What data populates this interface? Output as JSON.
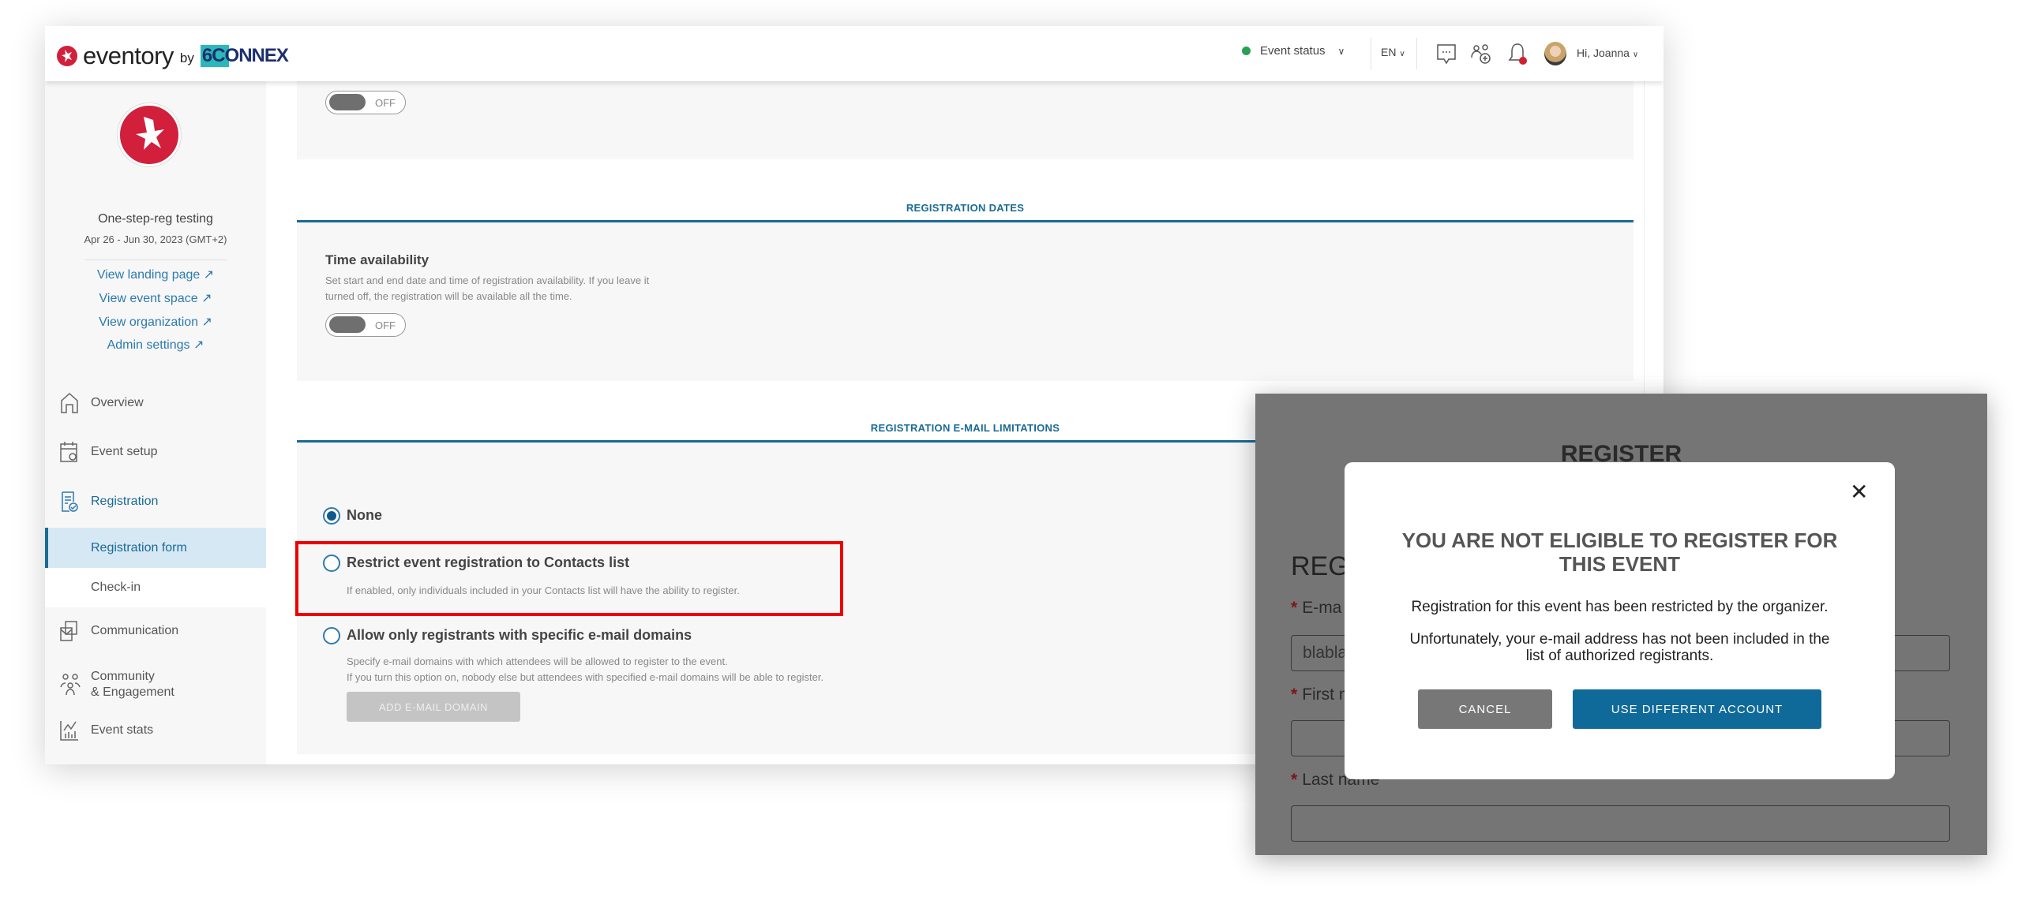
{
  "header": {
    "brand": "eventory",
    "by": "by",
    "partner": "6CONNEX",
    "event_status": "Event status",
    "status_color": "#2aa052",
    "language": "EN",
    "greeting": "Hi, Joanna"
  },
  "sidebar": {
    "event_name": "One-step-reg testing",
    "event_dates": "Apr 26 - Jun 30, 2023 (GMT+2)",
    "links": [
      "View landing page",
      "View event space",
      "View organization",
      "Admin settings"
    ],
    "nav": [
      {
        "label": "Overview",
        "icon": "home-icon"
      },
      {
        "label": "Event setup",
        "icon": "calendar-gear-icon"
      },
      {
        "label": "Registration",
        "icon": "registration-icon",
        "active": true
      },
      {
        "label": "Registration form",
        "sub": true,
        "selected": true
      },
      {
        "label": "Check-in",
        "sub": true
      },
      {
        "label": "Communication",
        "icon": "communication-icon"
      },
      {
        "label": "Community",
        "label2": "& Engagement",
        "icon": "community-icon"
      },
      {
        "label": "Event stats",
        "icon": "stats-icon"
      }
    ]
  },
  "main": {
    "top_toggle": "OFF",
    "registration_dates": {
      "title": "REGISTRATION DATES",
      "field": "Time availability",
      "description_line1": "Set start and end date and time of registration availability. If you leave it",
      "description_line2": "turned off, the registration will be available all the time.",
      "toggle": "OFF"
    },
    "email_limitations": {
      "title": "REGISTRATION E-MAIL LIMITATIONS",
      "options": [
        {
          "label": "None",
          "selected": true
        },
        {
          "label": "Restrict event registration to Contacts list",
          "description": "If enabled, only individuals included in your Contacts list will have the ability to register.",
          "highlighted": true
        },
        {
          "label": "Allow only registrants with specific e-mail domains",
          "description_line1": "Specify e-mail domains with which attendees will be allowed to register to the event.",
          "description_line2": "If you turn this option on, nobody else but attendees with specified e-mail domains will be able to register."
        }
      ],
      "add_domain_button": "ADD E-MAIL DOMAIN"
    }
  },
  "register_form": {
    "title": "REGISTER",
    "subtitle": "REGI",
    "email_label": "E-ma",
    "email_value": "blabla",
    "first_label": "First n",
    "last_label": "Last name",
    "required": "*"
  },
  "modal": {
    "title_line1": "YOU ARE NOT ELIGIBLE TO REGISTER FOR",
    "title_line2": "THIS EVENT",
    "message1": "Registration for this event has been restricted by the organizer.",
    "message2_line1": "Unfortunately, your e-mail address has not been included in the",
    "message2_line2": "list of authorized registrants.",
    "cancel": "CANCEL",
    "use_different": "USE DIFFERENT ACCOUNT",
    "accent": "#0f6a99",
    "highlight_color": "#ee0000"
  }
}
